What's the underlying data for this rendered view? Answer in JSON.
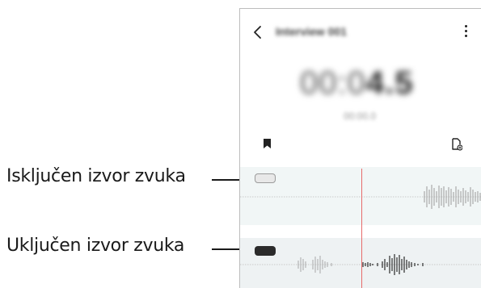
{
  "callouts": {
    "muted_source": "Isključen izvor zvuka",
    "active_source": "Uključen izvor zvuka"
  },
  "header": {
    "title": "Interview 001",
    "back_icon": "chevron-left-icon",
    "more_icon": "more-vert-icon"
  },
  "timer": {
    "main_prefix": "00:0",
    "main_secs": "4.5",
    "sub": "00:00.0"
  },
  "toolbar": {
    "bookmark_icon": "bookmark-icon",
    "add_icon": "add-document-icon"
  },
  "tracks": [
    {
      "state": "muted",
      "toggle_color": "#e8e8e8"
    },
    {
      "state": "active",
      "toggle_color": "#2b2b2b"
    }
  ],
  "colors": {
    "playhead": "#e76b6b",
    "waveform": "#8a8a8a",
    "waveform_active": "#333333"
  }
}
